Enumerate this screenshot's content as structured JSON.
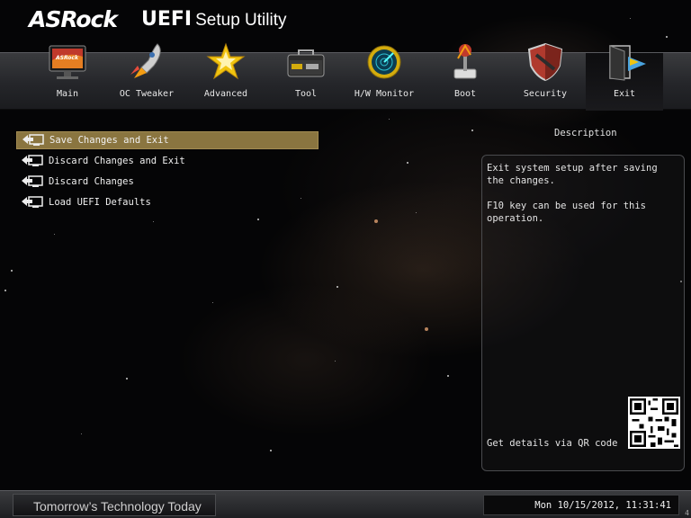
{
  "header": {
    "brand": "ASRock",
    "product": "UEFI",
    "product_suffix": "Setup Utility"
  },
  "nav": {
    "tabs": [
      {
        "label": "Main",
        "icon": "monitor-icon",
        "active": false
      },
      {
        "label": "OC Tweaker",
        "icon": "rocket-icon",
        "active": false
      },
      {
        "label": "Advanced",
        "icon": "star-icon",
        "active": false
      },
      {
        "label": "Tool",
        "icon": "toolbox-icon",
        "active": false
      },
      {
        "label": "H/W Monitor",
        "icon": "radar-icon",
        "active": false
      },
      {
        "label": "Boot",
        "icon": "joystick-icon",
        "active": false
      },
      {
        "label": "Security",
        "icon": "shield-icon",
        "active": false
      },
      {
        "label": "Exit",
        "icon": "exit-door-icon",
        "active": true
      }
    ]
  },
  "menu": {
    "items": [
      {
        "label": "Save Changes and Exit",
        "selected": true
      },
      {
        "label": "Discard Changes and Exit",
        "selected": false
      },
      {
        "label": "Discard Changes",
        "selected": false
      },
      {
        "label": "Load UEFI Defaults",
        "selected": false
      }
    ]
  },
  "description": {
    "title": "Description",
    "line1": "Exit system setup after saving the changes.",
    "line2": "F10 key can be used for this operation.",
    "qr_label": "Get details via QR code"
  },
  "footer": {
    "slogan": "Tomorrow’s Technology Today",
    "datetime": "Mon 10/15/2012, 11:31:41",
    "corner": "4"
  },
  "colors": {
    "selection": "#8a7540",
    "background": "#050506",
    "navbar": "#2a2b2e"
  }
}
